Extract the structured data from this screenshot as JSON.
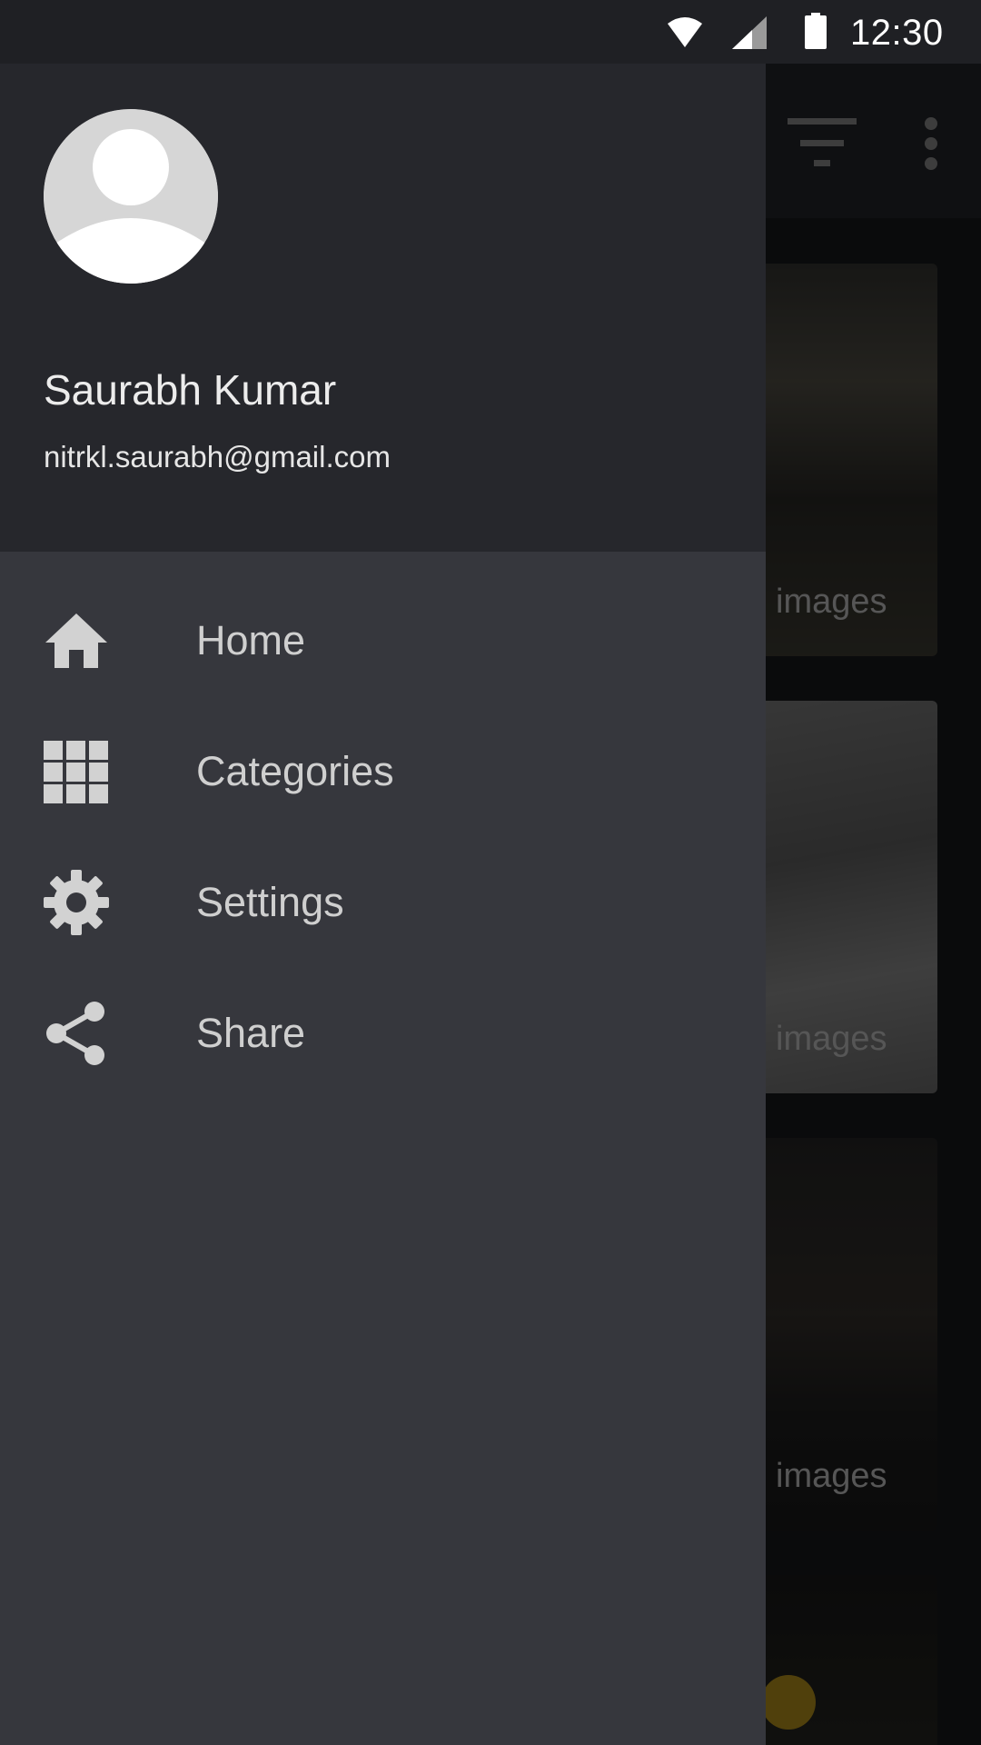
{
  "status_bar": {
    "time": "12:30"
  },
  "background_feed": {
    "cards": [
      {
        "label": "images"
      },
      {
        "label": "images"
      },
      {
        "label": "images"
      }
    ]
  },
  "drawer": {
    "header": {
      "name": "Saurabh Kumar",
      "email": "nitrkl.saurabh@gmail.com"
    },
    "items": [
      {
        "label": "Home",
        "icon": "home-icon"
      },
      {
        "label": "Categories",
        "icon": "grid-icon"
      },
      {
        "label": "Settings",
        "icon": "gear-icon"
      },
      {
        "label": "Share",
        "icon": "share-icon"
      }
    ]
  },
  "colors": {
    "drawer_bg": "#36373d",
    "header_bg": "#26272c",
    "icon": "#d2d2d2",
    "label": "#cfcfcf"
  }
}
